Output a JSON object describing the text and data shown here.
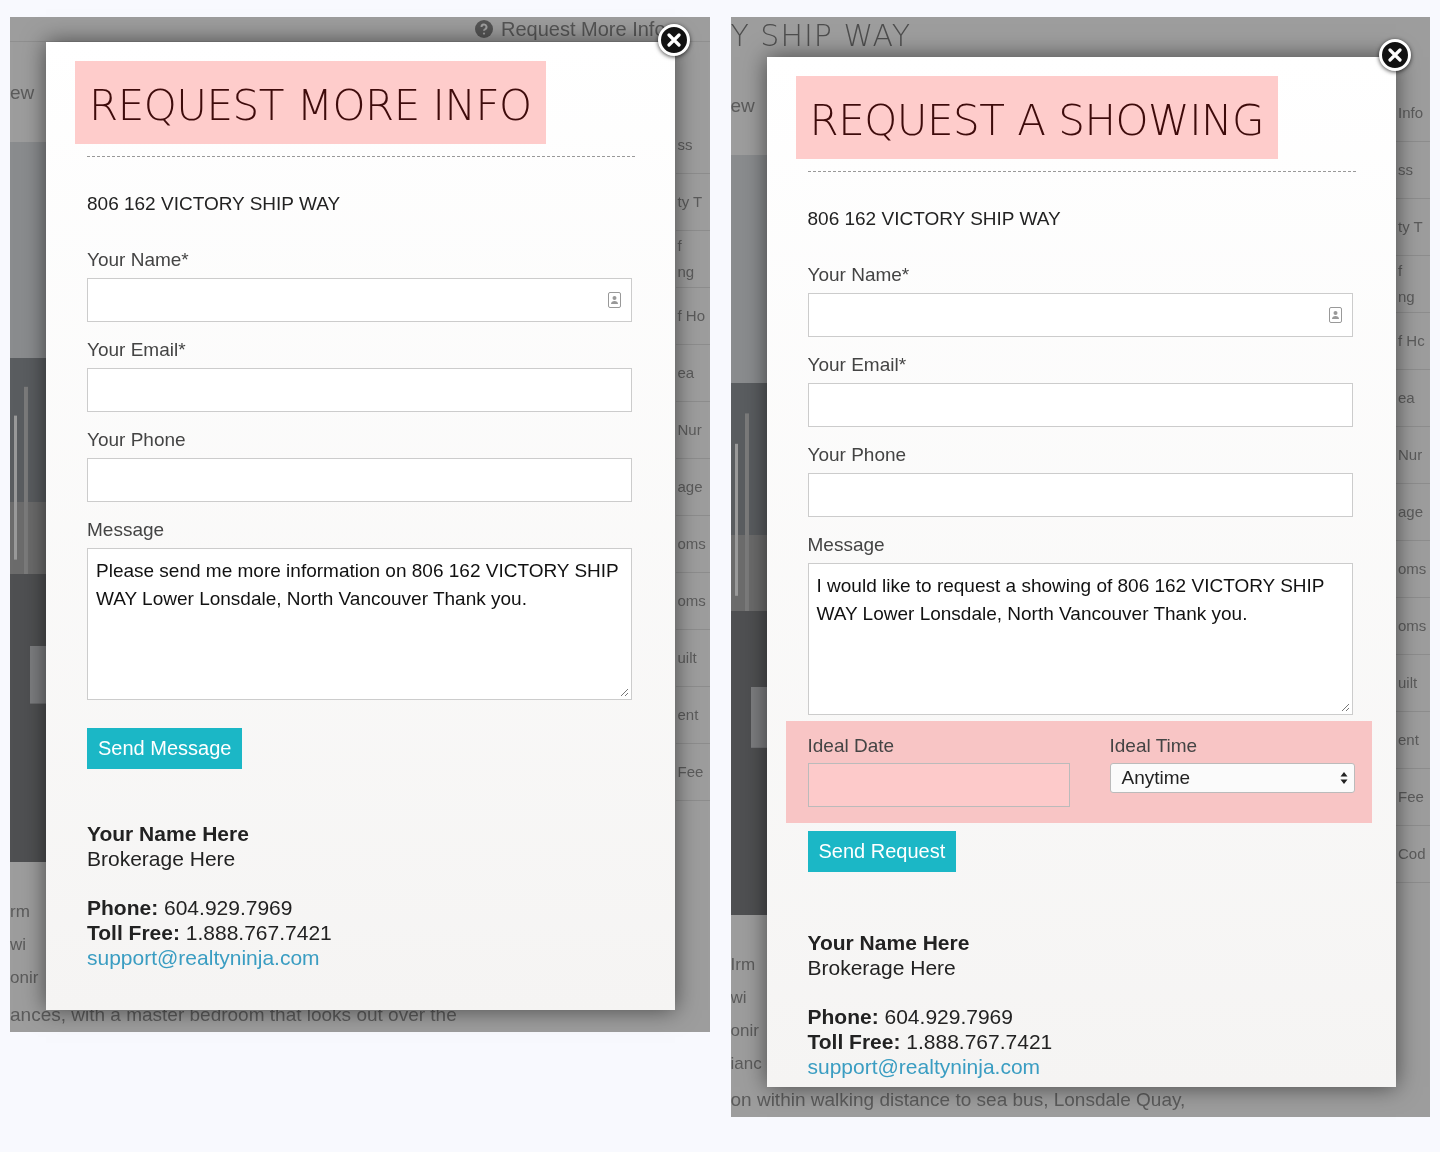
{
  "panels": [
    {
      "kind": "info",
      "background": {
        "header_link": "Request More Info",
        "left_top": "ew",
        "left_lines": [
          "rm",
          "wi",
          "onir"
        ],
        "bottom_line": "ances, with a master bedroom that looks out over the",
        "right_rows": [
          [
            "ss"
          ],
          [
            "ty T"
          ],
          [
            "f",
            "ng"
          ],
          [
            "f Ho"
          ],
          [
            "ea"
          ],
          [
            "Nur"
          ],
          [
            "age"
          ],
          [
            "oms"
          ],
          [
            "oms"
          ],
          [
            "uilt"
          ],
          [
            "ent"
          ],
          [
            "Fee"
          ]
        ]
      },
      "modal": {
        "title": "REQUEST MORE INFO",
        "address": "806 162 VICTORY SHIP WAY",
        "fields": [
          {
            "kind": "text",
            "label": "Your Name*",
            "autofill_icon": true
          },
          {
            "kind": "text",
            "label": "Your Email*",
            "autofill_icon": false
          },
          {
            "kind": "text",
            "label": "Your Phone",
            "autofill_icon": false
          },
          {
            "kind": "textarea",
            "label": "Message",
            "value": "Please send me more information on 806 162 VICTORY SHIP WAY Lower Lonsdale, North Vancouver Thank you."
          }
        ],
        "button": "Send Message",
        "contact": {
          "name": "Your Name Here",
          "brokerage": "Brokerage Here",
          "phone": "**Phone:** 604.929.7969",
          "toll_free": "**Toll Free:** 1.888.767.7421",
          "email": "support@realtyninja.com"
        }
      }
    },
    {
      "kind": "showing",
      "background": {
        "header_title": "Y SHIP WAY",
        "left_top": "ew",
        "left_lines": [
          "Irm",
          "wi",
          "onir",
          "ianc"
        ],
        "bottom_line": "on within walking distance to sea bus, Lonsdale Quay,",
        "right_rows": [
          [
            "Info"
          ],
          [
            "ss"
          ],
          [
            "ty T"
          ],
          [
            "f",
            "ng"
          ],
          [
            "f Hc"
          ],
          [
            "ea"
          ],
          [
            "Nur"
          ],
          [
            "age"
          ],
          [
            "oms"
          ],
          [
            "oms"
          ],
          [
            "uilt"
          ],
          [
            "ent"
          ],
          [
            "Fee"
          ],
          [
            "Cod"
          ]
        ]
      },
      "modal": {
        "title": "REQUEST A SHOWING",
        "address": "806 162 VICTORY SHIP WAY",
        "fields": [
          {
            "kind": "text",
            "label": "Your Name*",
            "autofill_icon": true
          },
          {
            "kind": "text",
            "label": "Your Email*",
            "autofill_icon": false
          },
          {
            "kind": "text",
            "label": "Your Phone",
            "autofill_icon": false
          },
          {
            "kind": "textarea",
            "label": "Message",
            "value": "I would like to request a showing of 806 162 VICTORY SHIP WAY Lower Lonsdale, North Vancouver Thank you."
          }
        ],
        "schedule": {
          "date_label": "Ideal Date",
          "time_label": "Ideal Time",
          "time_value": "Anytime"
        },
        "button": "Send Request",
        "contact": {
          "name": "Your Name Here",
          "brokerage": "Brokerage Here",
          "phone": "**Phone:** 604.929.7969",
          "toll_free": "**Toll Free:** 1.888.767.7421",
          "email": "support@realtyninja.com"
        }
      }
    }
  ]
}
